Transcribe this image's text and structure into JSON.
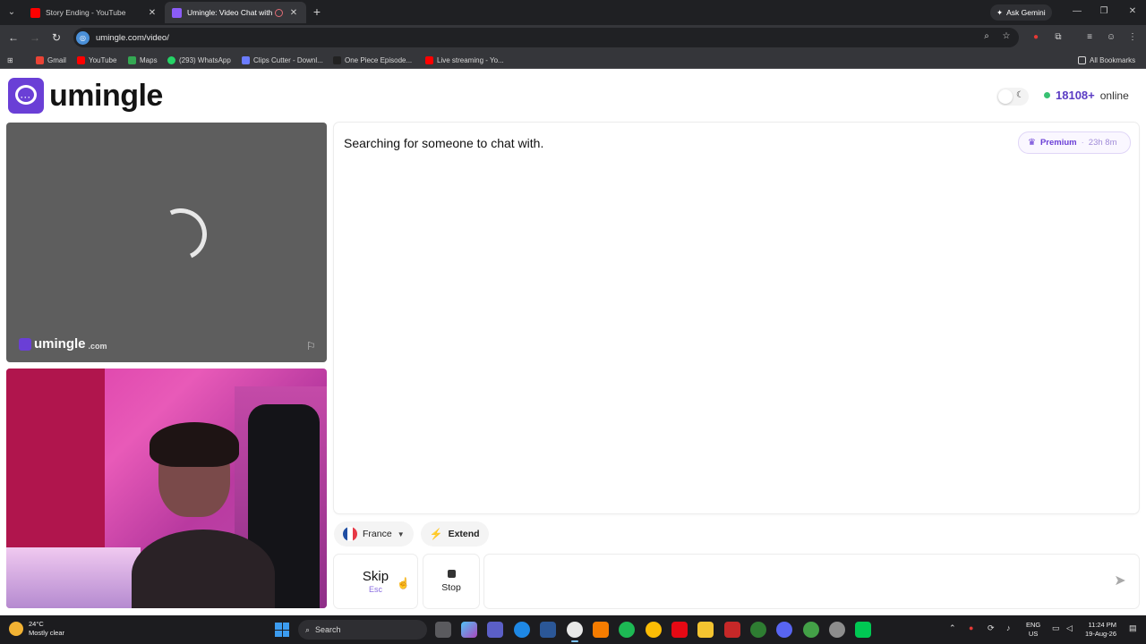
{
  "browser": {
    "tabs": [
      {
        "title": "Story Ending - YouTube",
        "favicon_color": "#ff0000",
        "active": false
      },
      {
        "title": "Umingle: Video Chat with St",
        "favicon_color": "#8b5cf6",
        "active": true
      }
    ],
    "ask_gemini_label": "Ask Gemini",
    "url": "umingle.com/video/",
    "bookmarks": [
      {
        "label": "Gmail",
        "icon_color": "#ea4335"
      },
      {
        "label": "YouTube",
        "icon_color": "#ff0000"
      },
      {
        "label": "Maps",
        "icon_color": "#34a853"
      },
      {
        "label": "(293) WhatsApp",
        "icon_color": "#25d366"
      },
      {
        "label": "Clips Cutter - Downl...",
        "icon_color": "#6b7cff"
      },
      {
        "label": "One Piece Episode...",
        "icon_color": "#222222"
      },
      {
        "label": "Live streaming - Yo...",
        "icon_color": "#ff0000"
      }
    ],
    "all_bookmarks_label": "All Bookmarks"
  },
  "header": {
    "logo_text": "umingle",
    "online_count": "18108+",
    "online_label": "online"
  },
  "stranger_video": {
    "watermark_text": "umingle",
    "watermark_domain": ".com"
  },
  "chat": {
    "status_text": "Searching for someone to chat with.",
    "premium_label": "Premium",
    "premium_separator": "·",
    "premium_time": "23h 8m"
  },
  "filters": {
    "country": "France",
    "extend_label": "Extend"
  },
  "controls": {
    "skip_label": "Skip",
    "skip_hint": "Esc",
    "stop_label": "Stop",
    "message_placeholder": ""
  },
  "taskbar": {
    "temperature": "24°C",
    "weather": "Mostly clear",
    "search_placeholder": "Search",
    "lang_primary": "ENG",
    "lang_secondary": "US",
    "time": "11:24 PM",
    "date": "19-Aug-26"
  },
  "colors": {
    "brand": "#6a3fd6",
    "online_dot": "#38c172",
    "online_count": "#5b3cc4"
  }
}
